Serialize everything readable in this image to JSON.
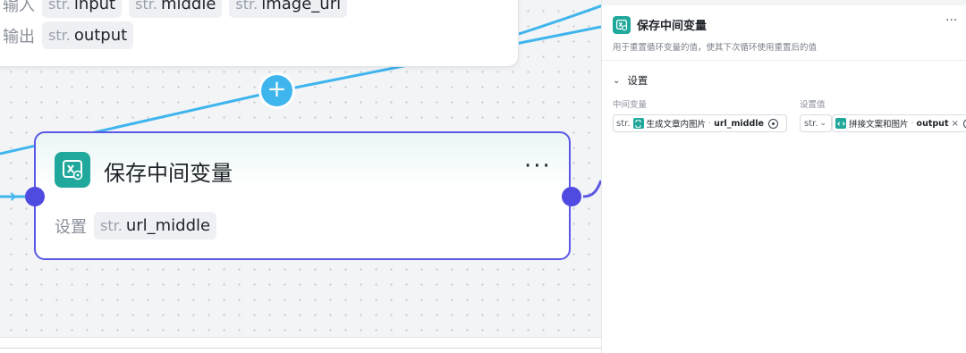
{
  "canvas": {
    "top_node": {
      "row1_label": "输入",
      "row1_chips": [
        {
          "type": "str.",
          "name": "input"
        },
        {
          "type": "str.",
          "name": "middle"
        },
        {
          "type": "str.",
          "name": "image_url"
        }
      ],
      "row2_label": "输出",
      "row2_chip": {
        "type": "str.",
        "name": "output"
      }
    },
    "add_button": "+",
    "main_node": {
      "title": "保存中间变量",
      "more": "···",
      "row_label": "设置",
      "chip": {
        "type": "str.",
        "name": "url_middle"
      }
    }
  },
  "panel": {
    "title": "保存中间变量",
    "more": "···",
    "description": "用于重置循环变量的值，使其下次循环使用重置后的值",
    "section": {
      "chevron": "⌄",
      "title": "设置"
    },
    "columns": {
      "left": "中间变量",
      "right": "设置值"
    },
    "left_var": {
      "type": "str.",
      "source": "生成文章内图片",
      "separator": "·",
      "name": "url_middle"
    },
    "right_select": {
      "type": "str.",
      "chevron": "⌄"
    },
    "right_var": {
      "source": "拼接文案和图片",
      "separator": "·",
      "name": "output",
      "clear": "×"
    }
  },
  "colors": {
    "accent_purple": "#5b58e5",
    "edge_blue": "#3fb5ee",
    "node_icon_teal": "#1fa89b"
  }
}
